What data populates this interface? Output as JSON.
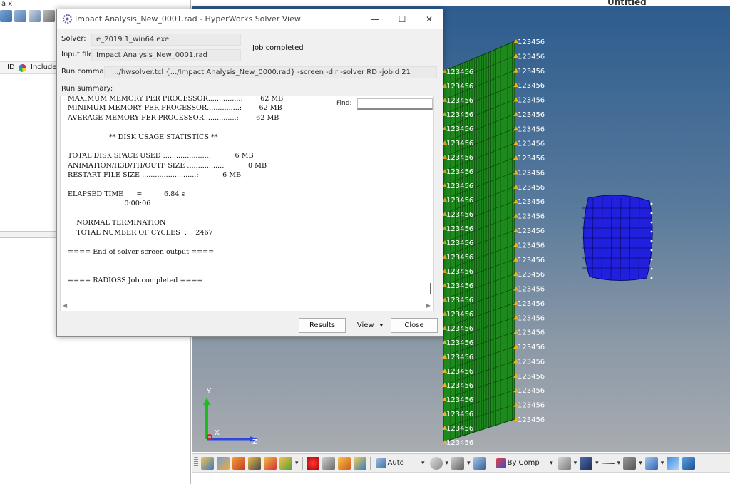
{
  "left_panel": {
    "tab_fragment": "a  x",
    "columns": {
      "id": "ID",
      "include": "Include"
    },
    "splitter_grip": "· ·"
  },
  "viewport": {
    "title": "Untitled",
    "node_label": "123456",
    "triad": {
      "y": "Y",
      "x": "X",
      "z": "Z"
    },
    "colors": {
      "plate": "#1e8a1e",
      "plate_lines": "#0a3d0a",
      "impactor": "#2020dd",
      "node_marker": "#f0b020"
    }
  },
  "dialog": {
    "title": "Impact Analysis_New_0001.rad - HyperWorks Solver View",
    "window_buttons": {
      "minimize": "—",
      "maximize": "☐",
      "close": "✕"
    },
    "solver_label": "Solver:",
    "solver_value": "e_2019.1_win64.exe",
    "input_label": "Input file:",
    "input_value": "Impact Analysis_New_0001.rad",
    "status": "Job completed",
    "run_command_label": "Run command:",
    "run_command_value": ".../hwsolver.tcl {.../Impact Analysis_New_0000.rad} -screen -dir -solver RD -jobid 21",
    "run_summary_label": "Run summary:",
    "find_label": "Find:",
    "find_value": "",
    "output_text": " MAXIMUM MEMORY PER PROCESSOR...............:        62 MB\n MINIMUM MEMORY PER PROCESSOR...............:        62 MB\n AVERAGE MEMORY PER PROCESSOR...............:        62 MB\n\n                    ** DISK USAGE STATISTICS **\n\n TOTAL DISK SPACE USED .....................:           6 MB\n ANIMATION/H3D/TH/OUTP SIZE ................:           0 MB\n RESTART FILE SIZE .........................:           6 MB\n\n ELAPSED TIME      =          6.84 s\n                           0:00:06\n\n     NORMAL TERMINATION\n     TOTAL NUMBER OF CYCLES  :    2467\n\n ==== End of solver screen output ====\n\n\n ==== RADIOSS Job completed ====",
    "buttons": {
      "results": "Results",
      "view": "View",
      "view_arrow": "▾",
      "close": "Close"
    }
  },
  "bottom_toolbar": {
    "auto_select": "Auto",
    "color_mode": "By Comp",
    "dropdown_arrow": "▾"
  }
}
